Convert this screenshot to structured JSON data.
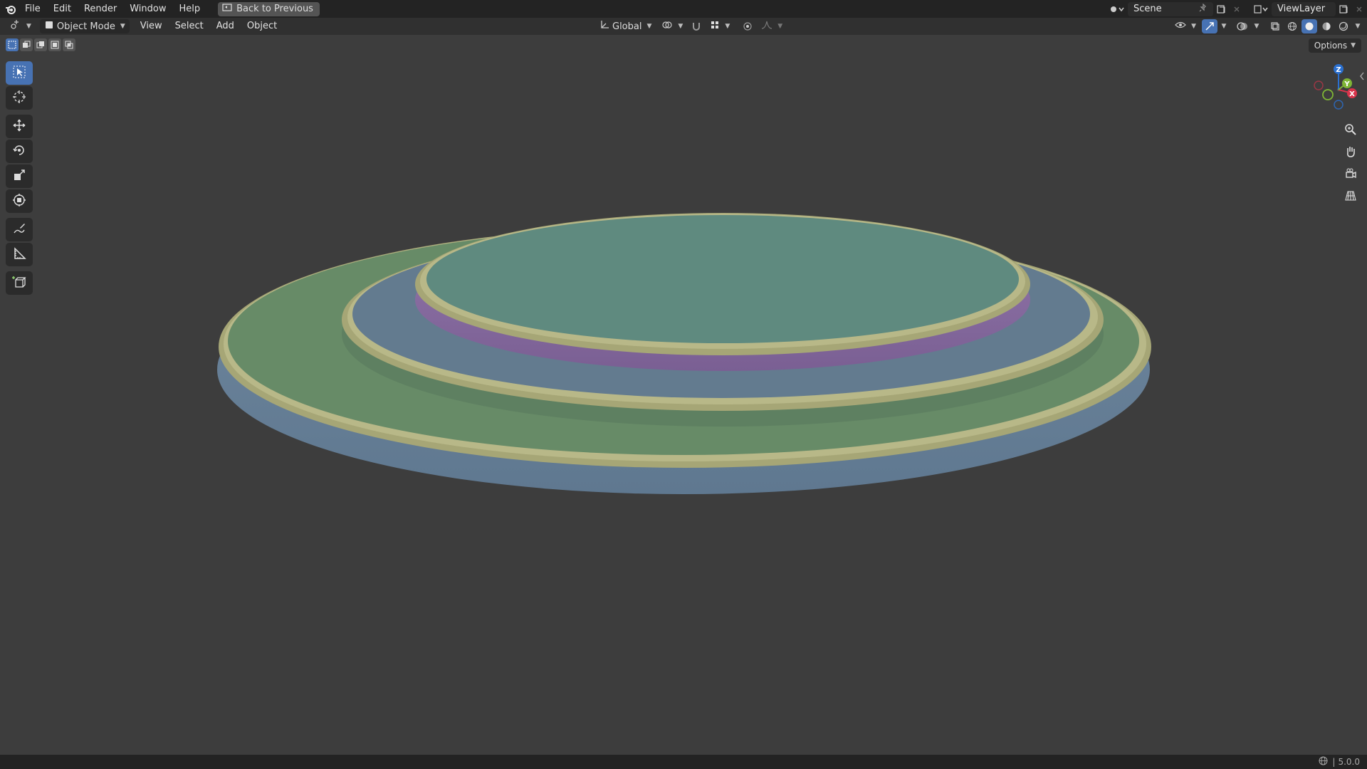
{
  "menu": {
    "items": [
      "File",
      "Edit",
      "Render",
      "Window",
      "Help"
    ],
    "back_label": "Back to Previous"
  },
  "topright": {
    "scene_label": "Scene",
    "viewlayer_label": "ViewLayer"
  },
  "header": {
    "mode_label": "Object Mode",
    "view_label": "View",
    "select_label": "Select",
    "add_label": "Add",
    "object_label": "Object",
    "transform_orientation": "Global"
  },
  "viewport": {
    "options_label": "Options",
    "gizmo_axes": {
      "x": "X",
      "y": "Y",
      "z": "Z"
    }
  },
  "status": {
    "version": "5.0.0"
  },
  "colors": {
    "accent": "#4772b3",
    "top_tier": "#5f8a7f",
    "mid_tier": "#637b8f",
    "base_tier": "#678b67",
    "rim": "#a8a878",
    "side_blue": "#6f879e",
    "side_purple": "#8a6ea2"
  }
}
